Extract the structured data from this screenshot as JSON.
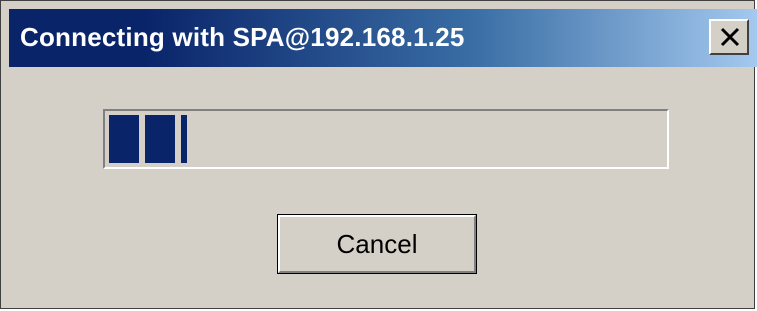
{
  "window": {
    "title": "Connecting with SPA@192.168.1.25",
    "close_icon": "close-x-icon"
  },
  "progress": {
    "fraction": 0.14
  },
  "buttons": {
    "cancel_label": "Cancel"
  },
  "colors": {
    "titlebar_start": "#0a246a",
    "titlebar_end": "#a6caf0",
    "dialog_face": "#d4d0c8",
    "progress_block": "#0a246a"
  }
}
